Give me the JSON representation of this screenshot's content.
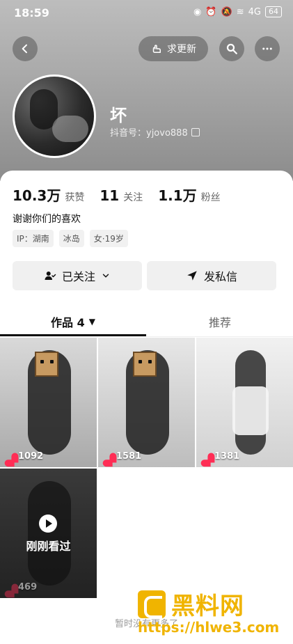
{
  "status_bar": {
    "time": "18:59",
    "signal": "4G",
    "battery": "64"
  },
  "header": {
    "request_update_label": "求更新",
    "username": "坏",
    "douyin_id": "抖音号：yjovo888"
  },
  "stats": [
    {
      "number": "10.3万",
      "label": "获赞"
    },
    {
      "number": "11",
      "label": "关注"
    },
    {
      "number": "1.1万",
      "label": "粉丝"
    }
  ],
  "bio": "谢谢你们的喜欢",
  "tags": [
    "IP：湖南",
    "冰岛",
    "女·19岁"
  ],
  "buttons": {
    "following": "已关注",
    "message": "发私信"
  },
  "tabs": [
    {
      "label": "作品 4"
    },
    {
      "label": "推荐"
    }
  ],
  "videos": [
    {
      "likes": "1092"
    },
    {
      "likes": "1581"
    },
    {
      "likes": "1381"
    },
    {
      "likes": "469",
      "overlay": "刚刚看过"
    }
  ],
  "footer_note": "暂时没有更多了",
  "watermark": {
    "brand": "黑料网",
    "url": "https://hlwe3.com"
  },
  "colors": {
    "accent_like": "#ff2d55",
    "watermark": "#f0b400"
  }
}
